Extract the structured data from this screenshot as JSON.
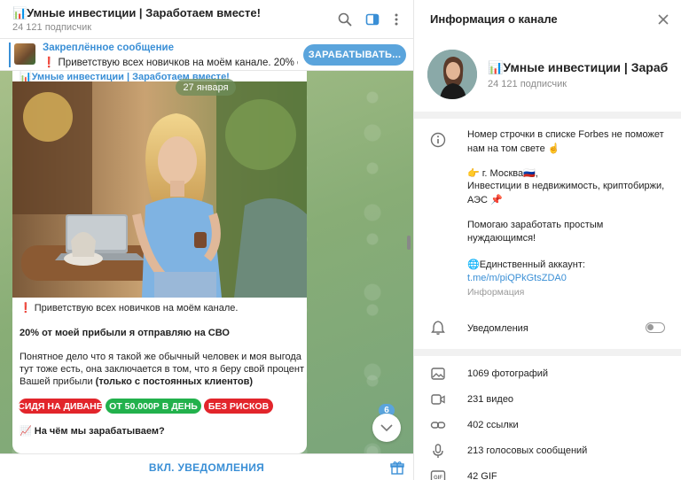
{
  "chat": {
    "title": "📊Умные инвестиции | Заработаем вместе!",
    "subscribers": "24 121 подписчик",
    "pinned": {
      "label": "Закреплённое сообщение",
      "warn": "❗",
      "text": "Приветствую всех новичков на моём канале.  20% от...",
      "button": "ЗАРАБАТЫВАТЬ..."
    },
    "message": {
      "author": "📊Умные инвестиции | Заработаем вместе!",
      "date": "27 января",
      "line1_warn": "❗",
      "line1": "Приветствую всех новичков на моём канале.",
      "line2": "20% от моей прибыли я отправляю на СВО",
      "line3": "Понятное дело что я такой же обычный человек и моя выгода",
      "line4": "тут тоже есть, она заключается в том, что я беру свой процент с",
      "line5_a": "Вашей прибыли ",
      "line5_b": "(только с постоянных клиентов)",
      "tags": [
        "СИДЯ НА ДИВАНЕ",
        "ОТ 50.000Р В ДЕНЬ",
        "БЕЗ РИСКОВ"
      ],
      "bottom_line": "📈 На чём мы зарабатываем?"
    },
    "unread_count": "6",
    "footer_button": "ВКЛ. УВЕДОМЛЕНИЯ"
  },
  "info": {
    "title": "Информация о канале",
    "channel_name": "📊Умные инвестиции | Зараб",
    "subscribers": "24 121 подписчик",
    "description": {
      "line1": "Номер строчки в списке Forbes не поможет",
      "line2": "нам на том свете ☝️",
      "line3": "👉 г. Москва🇷🇺,",
      "line4": "Инвестиции в недвижимость, криптобиржи,",
      "line5": "АЭС 📌",
      "line6": "Помогаю заработать простым",
      "line7": "нуждающимся!",
      "line8": "🌐Единственный аккаунт:",
      "link": "t.me/m/piQPkGtsZDA0",
      "caption": "Информация"
    },
    "notifications_label": "Уведомления",
    "media": [
      {
        "icon": "photo-icon",
        "label": "1069 фотографий"
      },
      {
        "icon": "video-icon",
        "label": "231 видео"
      },
      {
        "icon": "link-icon",
        "label": "402 ссылки"
      },
      {
        "icon": "microphone-icon",
        "label": "213 голосовых сообщений"
      },
      {
        "icon": "gif-icon",
        "label": "42 GIF"
      }
    ]
  },
  "colors": {
    "accent": "#3a8fd6",
    "button": "#5aa4dc",
    "tag_red": "#e2252b",
    "tag_green": "#22b14c",
    "chat_background": "#8fb37a"
  }
}
